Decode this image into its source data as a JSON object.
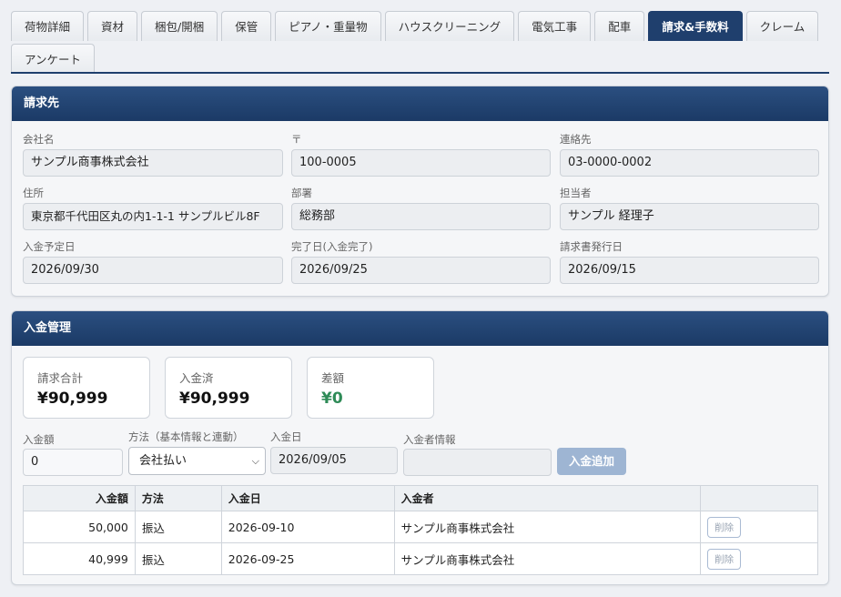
{
  "tabs": {
    "row1": [
      "荷物詳細",
      "資材",
      "梱包/開梱",
      "保管",
      "ピアノ・重量物",
      "ハウスクリーニング",
      "電気工事",
      "配車",
      "請求&手数料",
      "クレーム"
    ],
    "row2": [
      "アンケート"
    ],
    "active": "請求&手数料"
  },
  "billing": {
    "title": "請求先",
    "company_label": "会社名",
    "company_value": "サンプル商事株式会社",
    "zip_label": "〒",
    "zip_value": "100-0005",
    "contact_label": "連絡先",
    "contact_value": "03-0000-0002",
    "address_label": "住所",
    "address_value": "東京都千代田区丸の内1-1-1 サンプルビル8F",
    "dept_label": "部署",
    "dept_value": "総務部",
    "person_label": "担当者",
    "person_value": "サンプル 経理子",
    "due_label": "入金予定日",
    "due_value": "2026/09/30",
    "done_label": "完了日(入金完了)",
    "done_value": "2026/09/25",
    "invoice_label": "請求書発行日",
    "invoice_value": "2026/09/15"
  },
  "payment": {
    "title": "入金管理",
    "summary": {
      "total_label": "請求合計",
      "total_value": "¥90,999",
      "paid_label": "入金済",
      "paid_value": "¥90,999",
      "diff_label": "差額",
      "diff_value": "¥0"
    },
    "form": {
      "amount_label": "入金額",
      "amount_value": "0",
      "method_label": "方法（基本情報と連動）",
      "method_value": "会社払い",
      "date_label": "入金日",
      "date_value": "2026/09/05",
      "payer_label": "入金者情報",
      "payer_value": "",
      "add_button": "入金追加"
    },
    "table": {
      "headers": [
        "入金額",
        "方法",
        "入金日",
        "入金者",
        ""
      ],
      "rows": [
        {
          "amount": "50,000",
          "method": "振込",
          "date": "2026-09-10",
          "payer": "サンプル商事株式会社",
          "action": "削除"
        },
        {
          "amount": "40,999",
          "method": "振込",
          "date": "2026-09-25",
          "payer": "サンプル商事株式会社",
          "action": "削除"
        }
      ]
    }
  },
  "colors": {
    "header_blue": "#1f3f6d",
    "diff_green": "#2e8b57",
    "add_button": "#9eb5d3"
  }
}
